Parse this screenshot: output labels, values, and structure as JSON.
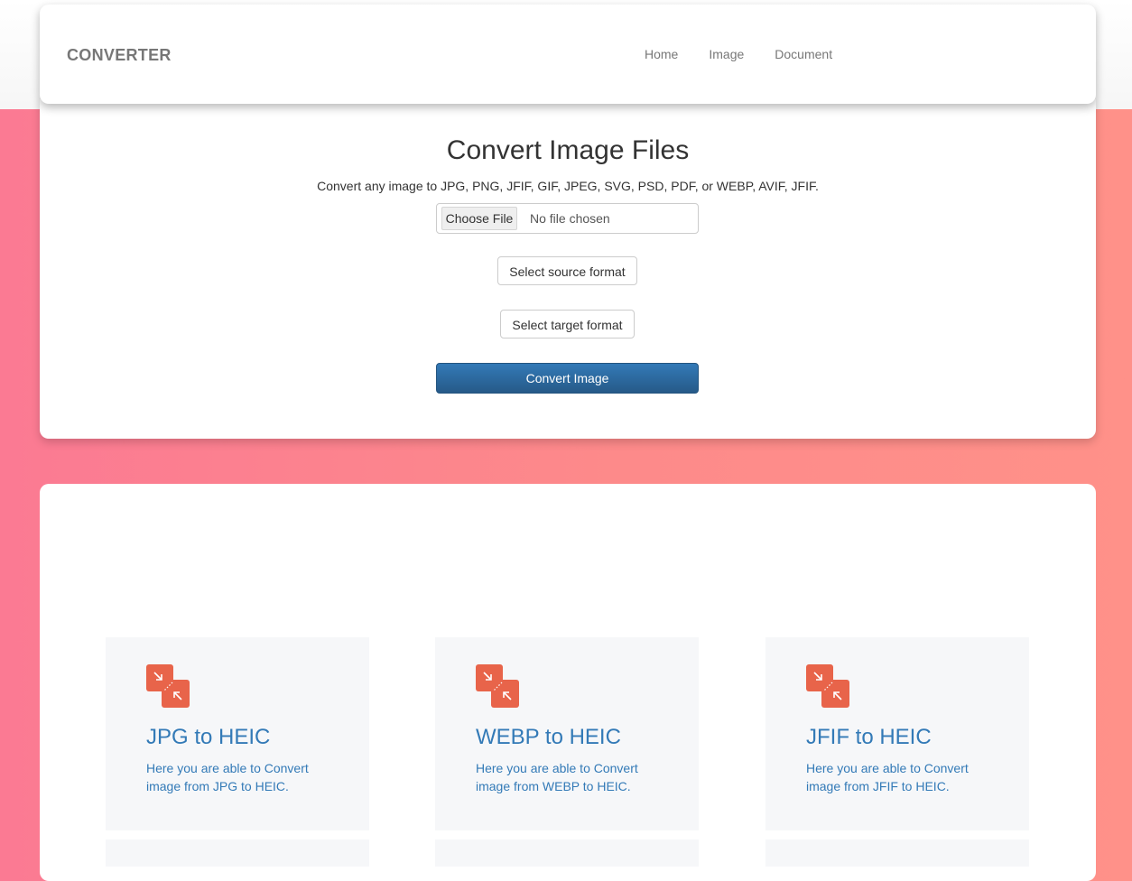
{
  "nav": {
    "brand": "CONVERTER",
    "links": [
      "Home",
      "Image",
      "Document"
    ]
  },
  "converter": {
    "title": "Convert Image Files",
    "subtitle": "Convert any image to JPG, PNG, JFIF, GIF, JPEG, SVG, PSD, PDF, or WEBP, AVIF, JFIF.",
    "file_button": "Choose File",
    "file_status": "No file chosen",
    "source_select": "Select source format",
    "target_select": "Select target format",
    "convert_button": "Convert Image"
  },
  "cards": [
    {
      "title": "JPG to HEIC",
      "desc": "Here you are able to Convert image from JPG to HEIC.",
      "icon": "convert-arrows-icon"
    },
    {
      "title": "WEBP to HEIC",
      "desc": "Here you are able to Convert image from WEBP to HEIC.",
      "icon": "convert-arrows-icon"
    },
    {
      "title": "JFIF to HEIC",
      "desc": "Here you are able to Convert image from JFIF to HEIC.",
      "icon": "convert-arrows-icon"
    }
  ],
  "colors": {
    "accent": "#337ab7",
    "icon": "#e8644a",
    "background_left": "#fb7a93",
    "background_right": "#ff9189"
  }
}
